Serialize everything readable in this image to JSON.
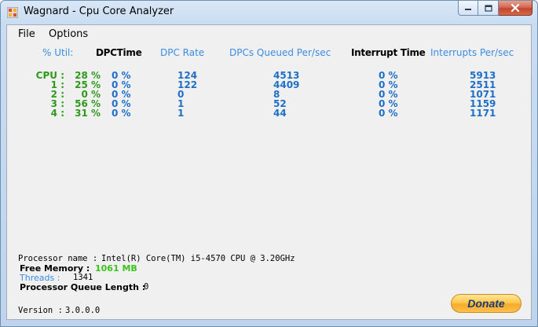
{
  "window": {
    "title": "Wagnard - Cpu Core Analyzer"
  },
  "menu": {
    "file": "File",
    "options": "Options"
  },
  "headers": {
    "util": "% Util:",
    "dpc_time": "DPCTime",
    "dpc_rate": "DPC Rate",
    "dpcs_queued": "DPCs Queued Per/sec",
    "interrupt_time": "Interrupt Time",
    "interrupts_per_sec": "Interrupts Per/sec"
  },
  "rows": [
    {
      "label": "CPU :",
      "util": "28 %",
      "dpc_time": "0 %",
      "dpc_rate": "124",
      "dpcs_queued": "4513",
      "interrupt_time": "0 %",
      "interrupts": "5913"
    },
    {
      "label": "1 :",
      "util": "25 %",
      "dpc_time": "0 %",
      "dpc_rate": "122",
      "dpcs_queued": "4409",
      "interrupt_time": "0 %",
      "interrupts": "2511"
    },
    {
      "label": "2 :",
      "util": "0 %",
      "dpc_time": "0 %",
      "dpc_rate": "0",
      "dpcs_queued": "8",
      "interrupt_time": "0 %",
      "interrupts": "1071"
    },
    {
      "label": "3 :",
      "util": "56 %",
      "dpc_time": "0 %",
      "dpc_rate": "1",
      "dpcs_queued": "52",
      "interrupt_time": "0 %",
      "interrupts": "1159"
    },
    {
      "label": "4 :",
      "util": "31 %",
      "dpc_time": "0 %",
      "dpc_rate": "1",
      "dpcs_queued": "44",
      "interrupt_time": "0 %",
      "interrupts": "1171"
    }
  ],
  "info": {
    "processor_label": "Processor name :",
    "processor_value": "Intel(R) Core(TM) i5-4570 CPU @ 3.20GHz",
    "free_memory_label": "Free Memory :",
    "free_memory_value": "1061 MB",
    "threads_label": "Threads :",
    "threads_value": "1341",
    "queue_label": "Processor Queue Length :",
    "queue_value": "0",
    "version_label": "Version :",
    "version_value": "3.0.0.0"
  },
  "donate_label": "Donate",
  "colors": {
    "green": "#2e9a1c",
    "blue_header": "#3a8de0",
    "blue_value": "#1d6fc8"
  }
}
